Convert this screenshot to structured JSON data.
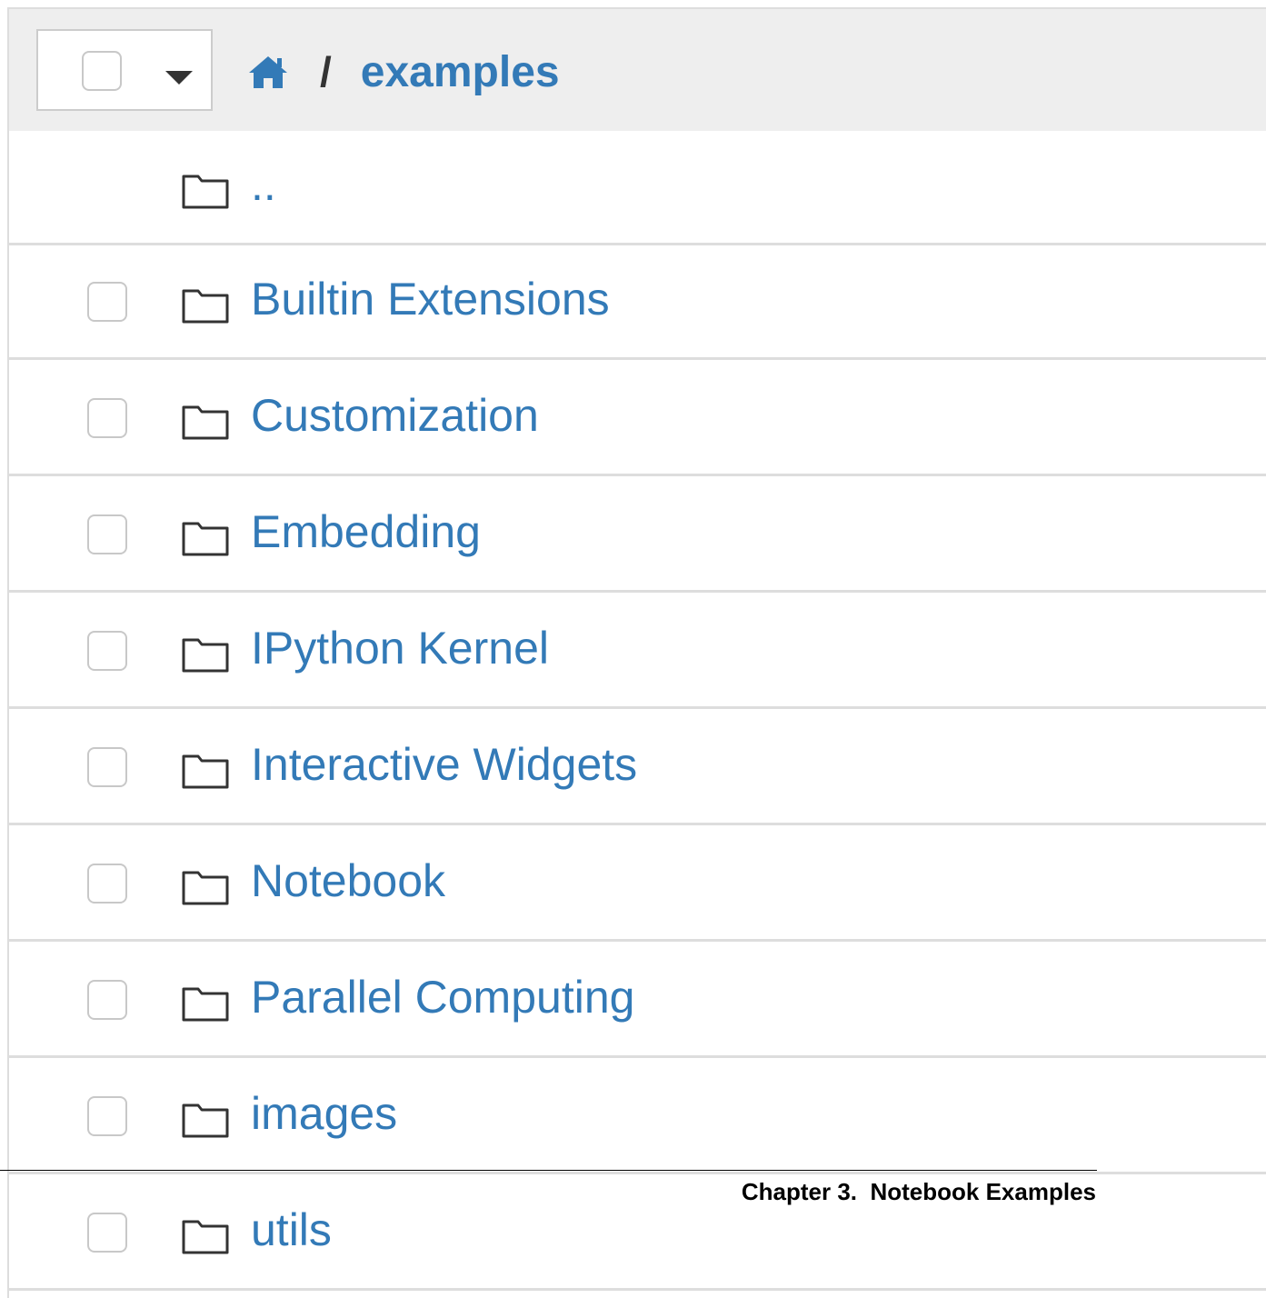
{
  "breadcrumb": {
    "home_icon": "home-icon",
    "separator": "/",
    "current": "examples"
  },
  "select_all": {
    "dropdown_icon": "caret-down-icon"
  },
  "parent_entry": {
    "name": "..",
    "icon": "folder-icon"
  },
  "entries": [
    {
      "name": "Builtin Extensions",
      "icon": "folder-icon"
    },
    {
      "name": "Customization",
      "icon": "folder-icon"
    },
    {
      "name": "Embedding",
      "icon": "folder-icon"
    },
    {
      "name": "IPython Kernel",
      "icon": "folder-icon"
    },
    {
      "name": "Interactive Widgets",
      "icon": "folder-icon"
    },
    {
      "name": "Notebook",
      "icon": "folder-icon"
    },
    {
      "name": "Parallel Computing",
      "icon": "folder-icon"
    },
    {
      "name": "images",
      "icon": "folder-icon"
    },
    {
      "name": "utils",
      "icon": "folder-icon"
    }
  ],
  "page_footer": "Chapter 3.  Notebook Examples",
  "colors": {
    "link": "#337ab7",
    "header_bg": "#eeeeee",
    "border": "#dddddd"
  }
}
